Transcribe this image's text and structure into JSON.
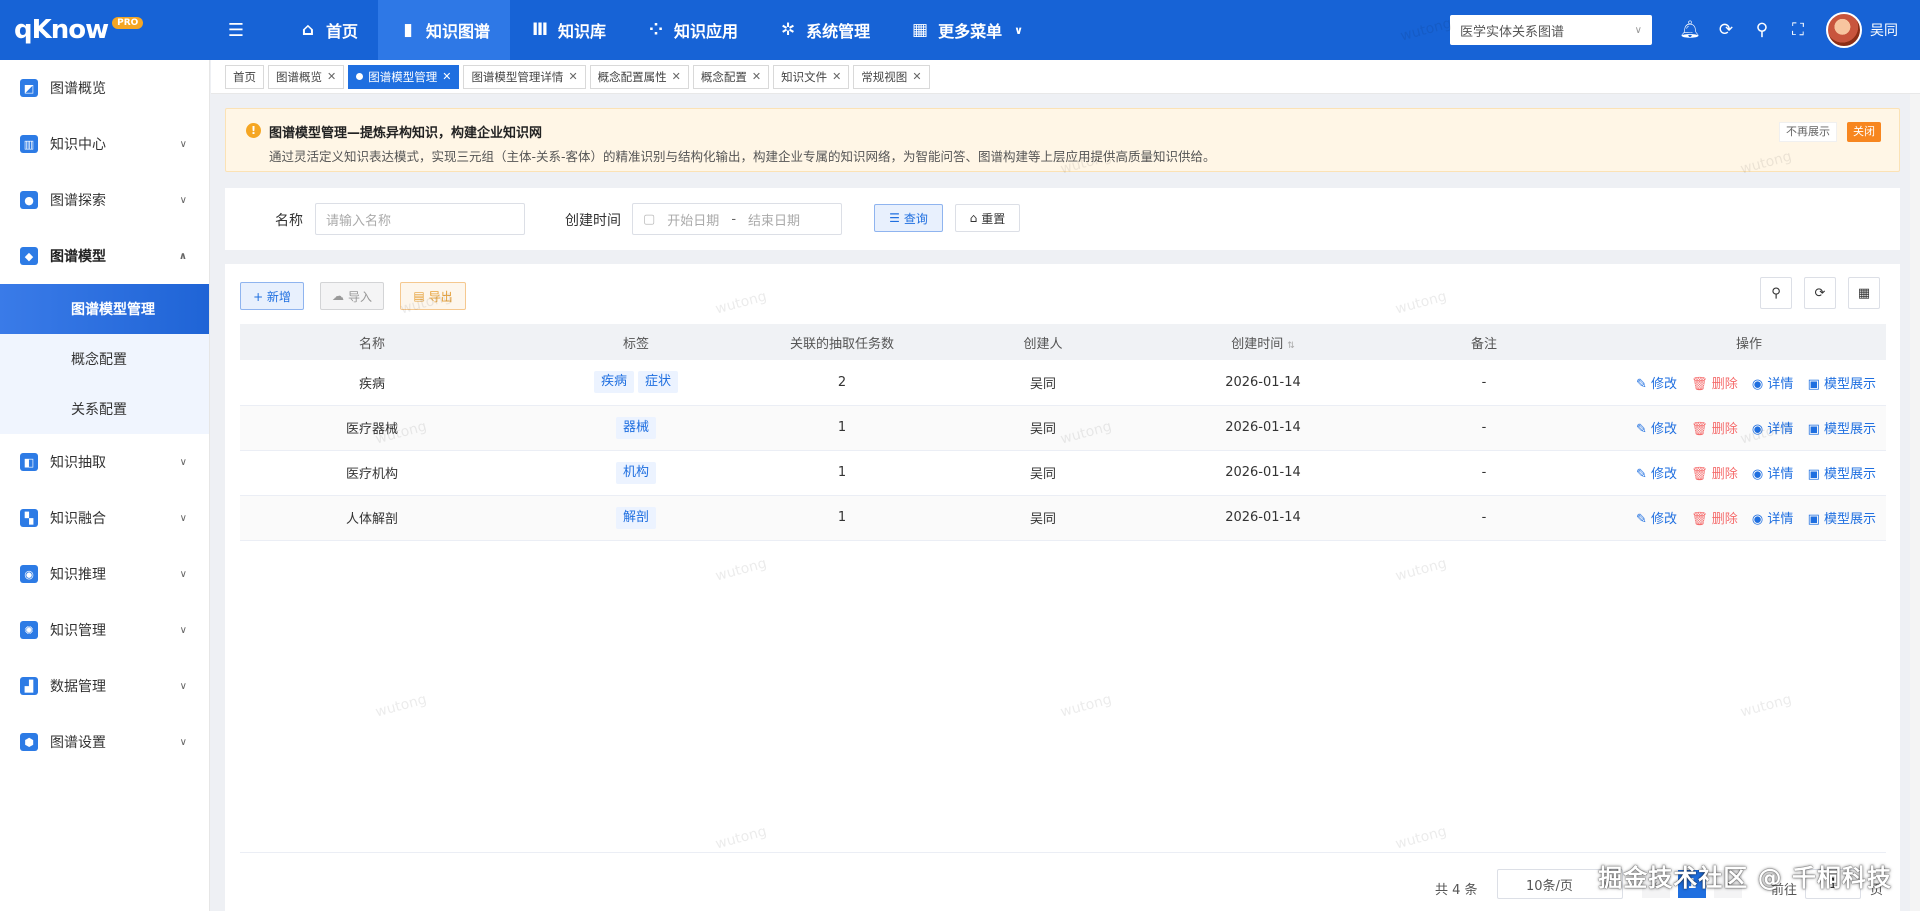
{
  "app": {
    "brand": "qKnow",
    "brand_badge": "PRO"
  },
  "topnav": {
    "items": [
      {
        "label": "首页",
        "icon": "home-icon",
        "active": false
      },
      {
        "label": "知识图谱",
        "icon": "book-icon",
        "active": true
      },
      {
        "label": "知识库",
        "icon": "library-icon",
        "active": false
      },
      {
        "label": "知识应用",
        "icon": "network-icon",
        "active": false
      },
      {
        "label": "系统管理",
        "icon": "gear-icon",
        "active": false
      },
      {
        "label": "更多菜单",
        "icon": "grid-icon",
        "active": false
      }
    ],
    "graph_select": "医学实体关系图谱",
    "user_name": "吴同"
  },
  "sidebar": {
    "items": [
      {
        "label": "图谱概览",
        "icon": "dashboard-icon",
        "color": "#2d7be5"
      },
      {
        "label": "知识中心",
        "icon": "book-icon",
        "color": "#2d7be5"
      },
      {
        "label": "图谱探索",
        "icon": "explore-icon",
        "color": "#2d7be5"
      },
      {
        "label": "图谱模型",
        "icon": "cube-icon",
        "color": "#2d7be5"
      },
      {
        "label": "知识抽取",
        "icon": "extract-icon",
        "color": "#2d7be5"
      },
      {
        "label": "知识融合",
        "icon": "merge-icon",
        "color": "#2d7be5"
      },
      {
        "label": "知识推理",
        "icon": "reasoning-icon",
        "color": "#2d7be5"
      },
      {
        "label": "知识管理",
        "icon": "manage-icon",
        "color": "#2d7be5"
      },
      {
        "label": "数据管理",
        "icon": "chart-icon",
        "color": "#2d7be5"
      },
      {
        "label": "图谱设置",
        "icon": "settings-icon",
        "color": "#2d7be5"
      }
    ],
    "sub_items": [
      {
        "label": "图谱模型管理",
        "active": true
      },
      {
        "label": "概念配置",
        "active": false
      },
      {
        "label": "关系配置",
        "active": false
      }
    ]
  },
  "tabs": [
    {
      "label": "首页",
      "closable": false,
      "active": false
    },
    {
      "label": "图谱概览",
      "closable": true,
      "active": false
    },
    {
      "label": "图谱模型管理",
      "closable": true,
      "active": true
    },
    {
      "label": "图谱模型管理详情",
      "closable": true,
      "active": false
    },
    {
      "label": "概念配置属性",
      "closable": true,
      "active": false
    },
    {
      "label": "概念配置",
      "closable": true,
      "active": false
    },
    {
      "label": "知识文件",
      "closable": true,
      "active": false
    },
    {
      "label": "常规视图",
      "closable": true,
      "active": false
    }
  ],
  "notice": {
    "title": "图谱模型管理—提炼异构知识，构建企业知识网",
    "desc": "通过灵活定义知识表达模式，实现三元组（主体-关系-客体）的精准识别与结构化输出，构建企业专属的知识网络，为智能问答、图谱构建等上层应用提供高质量知识供给。",
    "hide_label": "不再展示",
    "close_label": "关闭"
  },
  "search": {
    "name_label": "名称",
    "name_placeholder": "请输入名称",
    "time_label": "创建时间",
    "start_placeholder": "开始日期",
    "range_sep": "-",
    "end_placeholder": "结束日期",
    "query_label": "查询",
    "reset_label": "重置"
  },
  "actions": {
    "add": "+ 新增",
    "import": "导入",
    "export": "导出"
  },
  "table": {
    "headers": [
      "名称",
      "标签",
      "关联的抽取任务数",
      "创建人",
      "创建时间",
      "备注",
      "操作"
    ],
    "rows": [
      {
        "name": "疾病",
        "tags": [
          "疾病",
          "症状"
        ],
        "tasks": "2",
        "creator": "吴同",
        "created": "2026-01-14",
        "note": "-"
      },
      {
        "name": "医疗器械",
        "tags": [
          "器械"
        ],
        "tasks": "1",
        "creator": "吴同",
        "created": "2026-01-14",
        "note": "-"
      },
      {
        "name": "医疗机构",
        "tags": [
          "机构"
        ],
        "tasks": "1",
        "creator": "吴同",
        "created": "2026-01-14",
        "note": "-"
      },
      {
        "name": "人体解剖",
        "tags": [
          "解剖"
        ],
        "tasks": "1",
        "creator": "吴同",
        "created": "2026-01-14",
        "note": "-"
      }
    ],
    "ops": {
      "edit": "修改",
      "delete": "删除",
      "detail": "详情",
      "show": "模型展示"
    }
  },
  "pagination": {
    "total": "共 4 条",
    "page_size": "10条/页",
    "current": "1",
    "goto_label": "前往",
    "goto_value": "1",
    "page_suffix": "页"
  },
  "watermark": "wutong",
  "corner_mark": "掘金技术社区 @ 千桐科技"
}
